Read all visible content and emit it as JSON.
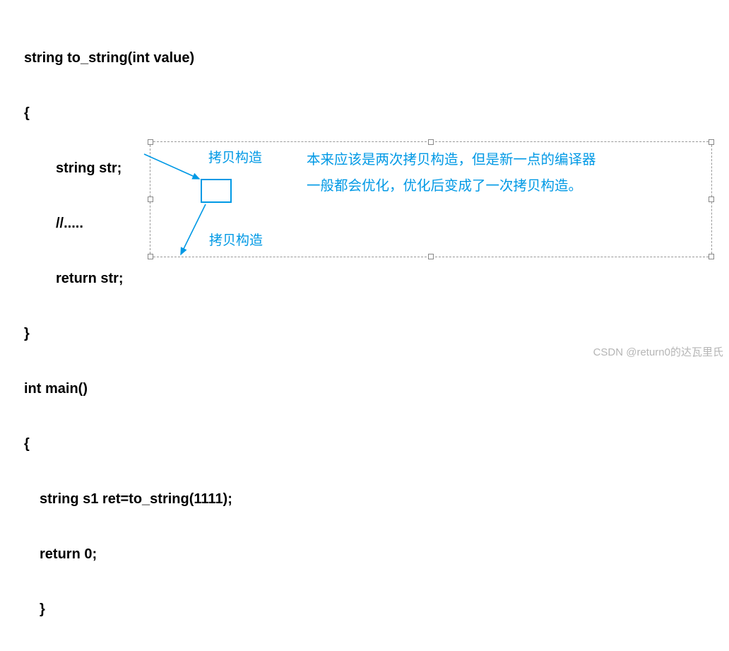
{
  "code": {
    "line1": "string to_string(int value)",
    "line2": "{",
    "line3": "string str;",
    "line4": "//.....",
    "line5": "return str;",
    "line6": "}",
    "line7": "int main()",
    "line8": "{",
    "line9": "string s1 ret=to_string(1111);",
    "line10": "return 0;",
    "line11": "}"
  },
  "annotations": {
    "copy_construct_1": "拷贝构造",
    "copy_construct_2": "拷贝构造",
    "explanation_line1": "本来应该是两次拷贝构造，但是新一点的编译器",
    "explanation_line2": "一般都会优化，优化后变成了一次拷贝构造。"
  },
  "watermark": "CSDN @return0的达瓦里氏"
}
